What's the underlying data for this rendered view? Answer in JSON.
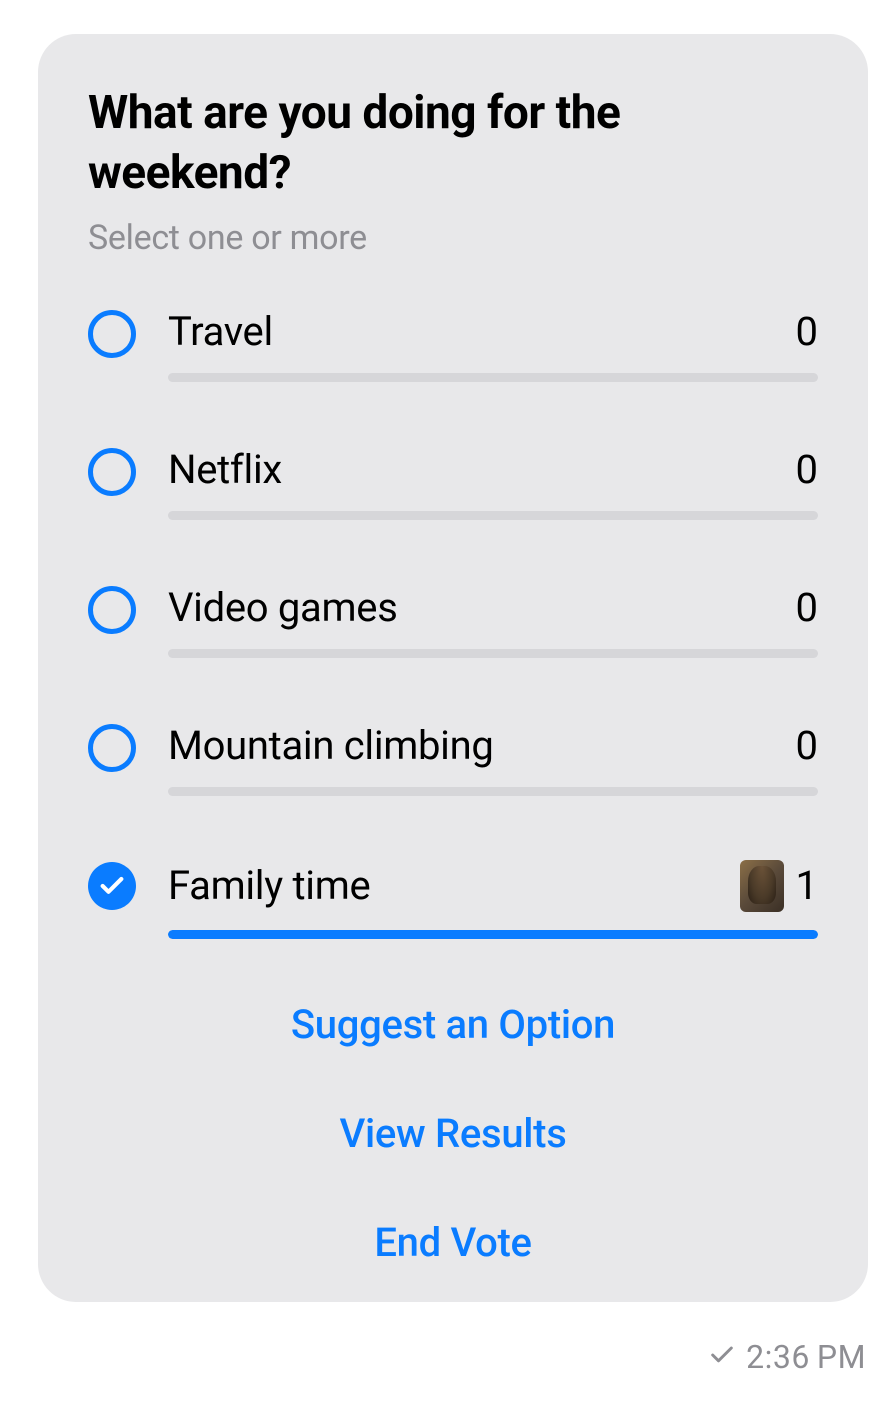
{
  "poll": {
    "question": "What are you doing for the weekend?",
    "subtitle": "Select one or more",
    "options": [
      {
        "label": "Travel",
        "count": "0",
        "selected": false,
        "percent": 0,
        "hasAvatar": false
      },
      {
        "label": "Netflix",
        "count": "0",
        "selected": false,
        "percent": 0,
        "hasAvatar": false
      },
      {
        "label": "Video games",
        "count": "0",
        "selected": false,
        "percent": 0,
        "hasAvatar": false
      },
      {
        "label": "Mountain climbing",
        "count": "0",
        "selected": false,
        "percent": 0,
        "hasAvatar": false
      },
      {
        "label": "Family time",
        "count": "1",
        "selected": true,
        "percent": 100,
        "hasAvatar": true
      }
    ],
    "actions": {
      "suggest": "Suggest an Option",
      "view_results": "View Results",
      "end_vote": "End Vote"
    }
  },
  "meta": {
    "timestamp": "2:36 PM"
  },
  "colors": {
    "accent": "#0a7cff",
    "card_bg": "#e8e8ea",
    "muted": "#8e8e93",
    "track": "#d6d6d9"
  }
}
